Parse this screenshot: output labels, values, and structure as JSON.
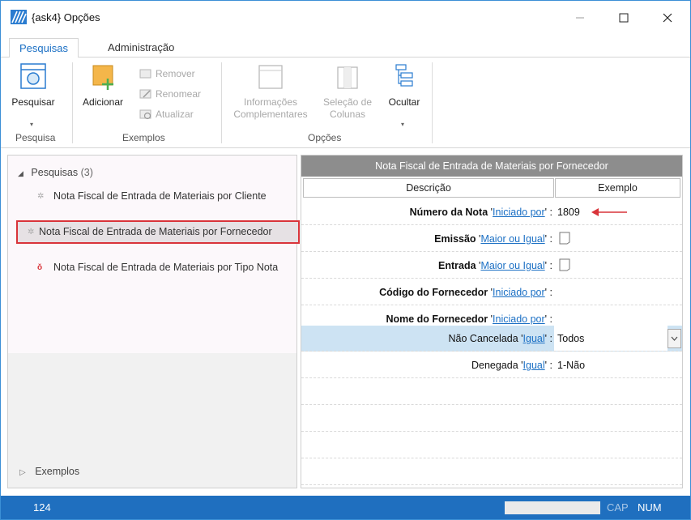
{
  "window": {
    "title": "{ask4}  Opções"
  },
  "tabs": [
    {
      "label": "Pesquisas",
      "active": true
    },
    {
      "label": "Administração",
      "active": false
    }
  ],
  "ribbon": {
    "pesquisar": "Pesquisar",
    "adicionar": "Adicionar",
    "remover": "Remover",
    "renomear": "Renomear",
    "atualizar": "Atualizar",
    "info_line1": "Informações",
    "info_line2": "Complementares",
    "selecao_line1": "Seleção de",
    "selecao_line2": "Colunas",
    "ocultar": "Ocultar",
    "group_pesquisa": "Pesquisa",
    "group_exemplos": "Exemplos",
    "group_opcoes": "Opções"
  },
  "tree": {
    "root_label": "Pesquisas",
    "root_count": "(3)",
    "items": [
      {
        "label": "Nota Fiscal de Entrada de Materiais por Cliente"
      },
      {
        "label": "Nota Fiscal de Entrada de Materiais por Fornecedor",
        "selected": true
      },
      {
        "label": "Nota Fiscal de Entrada de Materiais por Tipo Nota"
      }
    ],
    "exemplos_label": "Exemplos"
  },
  "grid": {
    "title": "Nota Fiscal de Entrada de Materiais por Fornecedor",
    "col_desc": "Descrição",
    "col_example": "Exemplo",
    "rows": [
      {
        "label": "Número da Nota",
        "op": "Iniciado por",
        "value": "1809"
      },
      {
        "label": "Emissão",
        "op": "Maior ou Igual",
        "value": ""
      },
      {
        "label": "Entrada",
        "op": "Maior ou Igual",
        "value": ""
      },
      {
        "label": "Código do Fornecedor",
        "op": "Iniciado por",
        "value": ""
      },
      {
        "label": "Nome do Fornecedor",
        "op": "Iniciado por",
        "value": ""
      },
      {
        "label": "Não Cancelada",
        "op": "Igual",
        "value": "Todos"
      },
      {
        "label": "Denegada",
        "op": "Igual",
        "value": "1-Não"
      }
    ]
  },
  "status": {
    "left": "124",
    "cap": "CAP",
    "num": "NUM"
  },
  "colors": {
    "accent": "#1f6fbf",
    "selection_border": "#d9343a",
    "grid_header": "#8d8d8d",
    "row_selected": "#cde3f3"
  }
}
